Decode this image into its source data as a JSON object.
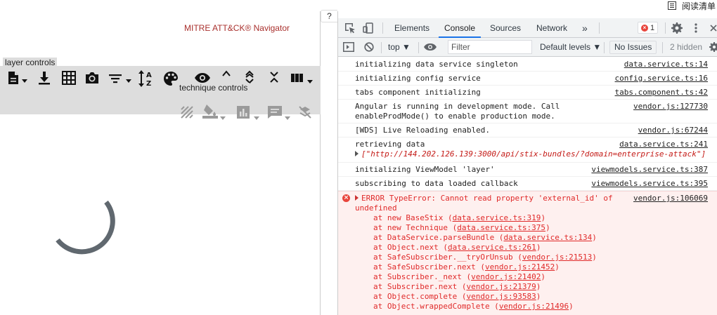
{
  "topbar": {
    "reading_list": "阅读清单"
  },
  "navigator": {
    "title": "MITRE ATT&CK® Navigator",
    "help": "?",
    "tooltips": {
      "layer_controls": "layer controls",
      "technique_controls": "technique controls"
    },
    "layer_icons": [
      "file-dropdown-icon",
      "download-icon",
      "grid-icon",
      "camera-icon",
      "filter-dropdown-icon",
      "sort-az-icon",
      "palette-icon",
      "eye-icon",
      "expand-up-icon",
      "expand-vertical-icon",
      "collapse-icon",
      "layout-dropdown-icon"
    ],
    "technique_icons": [
      "deselect-icon",
      "fill-color-dropdown-icon",
      "score-dropdown-icon",
      "comment-dropdown-icon",
      "disable-icon"
    ],
    "loading": true
  },
  "devtools": {
    "tabs": [
      "Elements",
      "Console",
      "Sources",
      "Network"
    ],
    "active_tab": "Console",
    "more_tabs": "»",
    "error_count": "1",
    "context": "top",
    "filter_placeholder": "Filter",
    "default_levels": "Default levels ▼",
    "no_issues": "No Issues",
    "hidden": "2 hidden",
    "messages": [
      {
        "text": "initializing data service singleton",
        "source": "data.service.ts:14"
      },
      {
        "text": "initializing config service",
        "source": "config.service.ts:16"
      },
      {
        "text": "tabs component initializing",
        "source": "tabs.component.ts:42"
      },
      {
        "text": "Angular is running in development mode. Call\nenableProdMode() to enable production mode.",
        "source": "vendor.js:127730"
      },
      {
        "text": "[WDS] Live Reloading enabled.",
        "source": "vendor.js:67244"
      },
      {
        "text": "retrieving data",
        "source": "data.service.ts:241",
        "expand": "[\"http://144.202.126.139:3000/api/stix-bundles/?domain=enterprise-attack\"]"
      },
      {
        "text": "initializing ViewModel 'layer'",
        "source": "viewmodels.service.ts:387"
      },
      {
        "text": "subscribing to data loaded callback",
        "source": "viewmodels.service.ts:395"
      }
    ],
    "error": {
      "text": "ERROR TypeError: Cannot read property 'external_id' of\nundefined",
      "source": "vendor.js:106069",
      "stack": [
        {
          "at": "at new BaseStix (",
          "loc": "data.service.ts:319",
          "end": ")"
        },
        {
          "at": "at new Technique (",
          "loc": "data.service.ts:375",
          "end": ")"
        },
        {
          "at": "at DataService.parseBundle (",
          "loc": "data.service.ts:134",
          "end": ")"
        },
        {
          "at": "at Object.next (",
          "loc": "data.service.ts:261",
          "end": ")"
        },
        {
          "at": "at SafeSubscriber.__tryOrUnsub (",
          "loc": "vendor.js:21513",
          "end": ")"
        },
        {
          "at": "at SafeSubscriber.next (",
          "loc": "vendor.js:21452",
          "end": ")"
        },
        {
          "at": "at Subscriber._next (",
          "loc": "vendor.js:21402",
          "end": ")"
        },
        {
          "at": "at Subscriber.next (",
          "loc": "vendor.js:21379",
          "end": ")"
        },
        {
          "at": "at Object.complete (",
          "loc": "vendor.js:93583",
          "end": ")"
        },
        {
          "at": "at Object.wrappedComplete (",
          "loc": "vendor.js:21496",
          "end": ")"
        }
      ]
    }
  }
}
